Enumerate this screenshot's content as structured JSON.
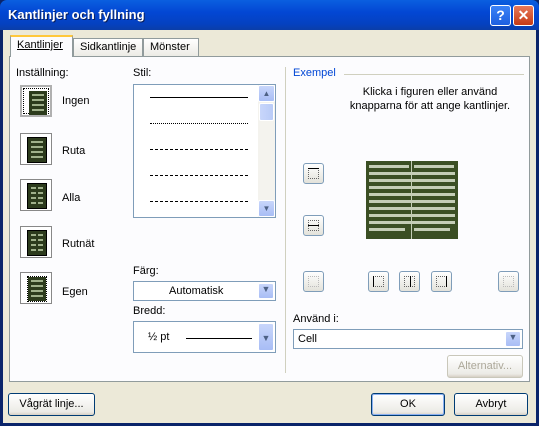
{
  "window": {
    "title": "Kantlinjer och fyllning",
    "help_btn": "?",
    "close_btn": "✕"
  },
  "tabs": [
    {
      "label": "Kantlinjer",
      "active": true
    },
    {
      "label": "Sidkantlinje",
      "active": false
    },
    {
      "label": "Mönster",
      "active": false
    }
  ],
  "settings": {
    "heading": "Inställning:",
    "items": [
      {
        "label": "Ingen",
        "selected": true
      },
      {
        "label": "Ruta",
        "selected": false
      },
      {
        "label": "Alla",
        "selected": false
      },
      {
        "label": "Rutnät",
        "selected": false
      },
      {
        "label": "Egen",
        "selected": false
      }
    ]
  },
  "style": {
    "heading": "Stil:",
    "color_label": "Färg:",
    "color_value": "Automatisk",
    "width_label": "Bredd:",
    "width_value": "½ pt"
  },
  "preview": {
    "heading": "Exempel",
    "instruction": "Klicka i figuren eller använd knapparna för att ange kantlinjer.",
    "apply_label": "Använd i:",
    "apply_value": "Cell",
    "options_button": "Alternativ..."
  },
  "footer": {
    "horizontal_line_button": "Vågrät linje...",
    "ok_button": "OK",
    "cancel_button": "Avbryt"
  },
  "colors": {
    "title_bar": "#0553de",
    "dialog_face": "#ece9d8",
    "preview_table": "#3b4f24",
    "group_heading": "#0046d5"
  }
}
